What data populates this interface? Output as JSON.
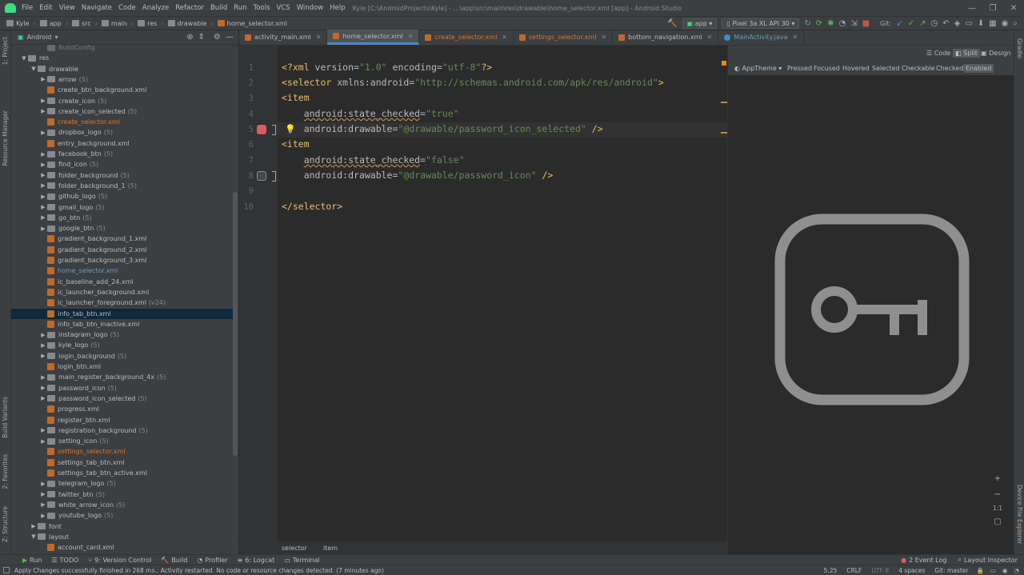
{
  "menubar": {
    "items": [
      "File",
      "Edit",
      "View",
      "Navigate",
      "Code",
      "Analyze",
      "Refactor",
      "Build",
      "Run",
      "Tools",
      "VCS",
      "Window",
      "Help"
    ],
    "title": "Kyle [C:\\AndroidProjects\\Kyle] - ...\\app\\src\\main\\res\\drawable\\home_selector.xml [app] - Android Studio"
  },
  "navbar": {
    "crumbs": [
      "Kyle",
      "app",
      "src",
      "main",
      "res",
      "drawable",
      "home_selector.xml"
    ],
    "run_config": "app",
    "device": "Pixel 3a XL API 30",
    "git_label": "Git:"
  },
  "project": {
    "view_label": "Android",
    "tree": [
      {
        "name": "BuildConfig",
        "count": "",
        "indent": 3,
        "arrow": "",
        "icon": "file",
        "state": "dim"
      },
      {
        "name": "res",
        "count": "",
        "indent": 1,
        "arrow": "▼",
        "icon": "folder",
        "state": ""
      },
      {
        "name": "drawable",
        "count": "",
        "indent": 2,
        "arrow": "▼",
        "icon": "folder",
        "state": ""
      },
      {
        "name": "arrow",
        "count": "(5)",
        "indent": 3,
        "arrow": "▶",
        "icon": "folder",
        "state": ""
      },
      {
        "name": "create_btn_background.xml",
        "count": "",
        "indent": 3,
        "arrow": "",
        "icon": "xml",
        "state": ""
      },
      {
        "name": "create_icon",
        "count": "(5)",
        "indent": 3,
        "arrow": "▶",
        "icon": "folder",
        "state": ""
      },
      {
        "name": "create_icon_selected",
        "count": "(5)",
        "indent": 3,
        "arrow": "▶",
        "icon": "folder",
        "state": ""
      },
      {
        "name": "create_selector.xml",
        "count": "",
        "indent": 3,
        "arrow": "",
        "icon": "xml",
        "state": "mod"
      },
      {
        "name": "dropbox_logo",
        "count": "(5)",
        "indent": 3,
        "arrow": "▶",
        "icon": "folder",
        "state": ""
      },
      {
        "name": "entry_background.xml",
        "count": "",
        "indent": 3,
        "arrow": "",
        "icon": "xml",
        "state": ""
      },
      {
        "name": "facebook_btn",
        "count": "(5)",
        "indent": 3,
        "arrow": "▶",
        "icon": "folder",
        "state": ""
      },
      {
        "name": "find_icon",
        "count": "(5)",
        "indent": 3,
        "arrow": "▶",
        "icon": "folder",
        "state": ""
      },
      {
        "name": "folder_background",
        "count": "(5)",
        "indent": 3,
        "arrow": "▶",
        "icon": "folder",
        "state": ""
      },
      {
        "name": "folder_background_1",
        "count": "(5)",
        "indent": 3,
        "arrow": "▶",
        "icon": "folder",
        "state": ""
      },
      {
        "name": "github_logo",
        "count": "(5)",
        "indent": 3,
        "arrow": "▶",
        "icon": "folder",
        "state": ""
      },
      {
        "name": "gmail_logo",
        "count": "(5)",
        "indent": 3,
        "arrow": "▶",
        "icon": "folder",
        "state": ""
      },
      {
        "name": "go_btn",
        "count": "(5)",
        "indent": 3,
        "arrow": "▶",
        "icon": "folder",
        "state": ""
      },
      {
        "name": "google_btn",
        "count": "(5)",
        "indent": 3,
        "arrow": "▶",
        "icon": "folder",
        "state": ""
      },
      {
        "name": "gradient_background_1.xml",
        "count": "",
        "indent": 3,
        "arrow": "",
        "icon": "xml",
        "state": ""
      },
      {
        "name": "gradient_background_2.xml",
        "count": "",
        "indent": 3,
        "arrow": "",
        "icon": "xml",
        "state": ""
      },
      {
        "name": "gradient_background_3.xml",
        "count": "",
        "indent": 3,
        "arrow": "",
        "icon": "xml",
        "state": ""
      },
      {
        "name": "home_selector.xml",
        "count": "",
        "indent": 3,
        "arrow": "",
        "icon": "xml",
        "state": "blue"
      },
      {
        "name": "ic_baseline_add_24.xml",
        "count": "",
        "indent": 3,
        "arrow": "",
        "icon": "xml",
        "state": ""
      },
      {
        "name": "ic_launcher_background.xml",
        "count": "",
        "indent": 3,
        "arrow": "",
        "icon": "xml",
        "state": ""
      },
      {
        "name": "ic_launcher_foreground.xml",
        "count": "(v24)",
        "indent": 3,
        "arrow": "",
        "icon": "xml",
        "state": ""
      },
      {
        "name": "info_tab_btn.xml",
        "count": "",
        "indent": 3,
        "arrow": "",
        "icon": "xml",
        "state": "sel"
      },
      {
        "name": "info_tab_btn_inactive.xml",
        "count": "",
        "indent": 3,
        "arrow": "",
        "icon": "xml",
        "state": ""
      },
      {
        "name": "instagram_logo",
        "count": "(5)",
        "indent": 3,
        "arrow": "▶",
        "icon": "folder",
        "state": ""
      },
      {
        "name": "kyle_logo",
        "count": "(5)",
        "indent": 3,
        "arrow": "▶",
        "icon": "folder",
        "state": ""
      },
      {
        "name": "login_background",
        "count": "(5)",
        "indent": 3,
        "arrow": "▶",
        "icon": "folder",
        "state": ""
      },
      {
        "name": "login_btn.xml",
        "count": "",
        "indent": 3,
        "arrow": "",
        "icon": "xml",
        "state": ""
      },
      {
        "name": "main_register_background_4x",
        "count": "(5)",
        "indent": 3,
        "arrow": "▶",
        "icon": "folder",
        "state": ""
      },
      {
        "name": "password_icon",
        "count": "(5)",
        "indent": 3,
        "arrow": "▶",
        "icon": "folder",
        "state": ""
      },
      {
        "name": "password_icon_selected",
        "count": "(5)",
        "indent": 3,
        "arrow": "▶",
        "icon": "folder",
        "state": ""
      },
      {
        "name": "progress.xml",
        "count": "",
        "indent": 3,
        "arrow": "",
        "icon": "xml",
        "state": ""
      },
      {
        "name": "register_btn.xml",
        "count": "",
        "indent": 3,
        "arrow": "",
        "icon": "xml",
        "state": ""
      },
      {
        "name": "registration_background",
        "count": "(5)",
        "indent": 3,
        "arrow": "▶",
        "icon": "folder",
        "state": ""
      },
      {
        "name": "setting_icon",
        "count": "(5)",
        "indent": 3,
        "arrow": "▶",
        "icon": "folder",
        "state": ""
      },
      {
        "name": "settings_selector.xml",
        "count": "",
        "indent": 3,
        "arrow": "",
        "icon": "xml",
        "state": "mod"
      },
      {
        "name": "settings_tab_btn.xml",
        "count": "",
        "indent": 3,
        "arrow": "",
        "icon": "xml",
        "state": ""
      },
      {
        "name": "settings_tab_btn_active.xml",
        "count": "",
        "indent": 3,
        "arrow": "",
        "icon": "xml",
        "state": ""
      },
      {
        "name": "telegram_logo",
        "count": "(5)",
        "indent": 3,
        "arrow": "▶",
        "icon": "folder",
        "state": ""
      },
      {
        "name": "twitter_btn",
        "count": "(5)",
        "indent": 3,
        "arrow": "▶",
        "icon": "folder",
        "state": ""
      },
      {
        "name": "white_arrow_icon",
        "count": "(5)",
        "indent": 3,
        "arrow": "▶",
        "icon": "folder",
        "state": ""
      },
      {
        "name": "youtube_logo",
        "count": "(5)",
        "indent": 3,
        "arrow": "▶",
        "icon": "folder",
        "state": ""
      },
      {
        "name": "font",
        "count": "",
        "indent": 2,
        "arrow": "▶",
        "icon": "folder",
        "state": ""
      },
      {
        "name": "layout",
        "count": "",
        "indent": 2,
        "arrow": "▼",
        "icon": "folder",
        "state": ""
      },
      {
        "name": "account_card.xml",
        "count": "",
        "indent": 3,
        "arrow": "",
        "icon": "xml",
        "state": ""
      }
    ]
  },
  "tabs": [
    {
      "label": "activity_main.xml",
      "type": "xml",
      "state": ""
    },
    {
      "label": "home_selector.xml",
      "type": "xml",
      "state": "active"
    },
    {
      "label": "create_selector.xml",
      "type": "xml",
      "state": "mod"
    },
    {
      "label": "settings_selector.xml",
      "type": "xml",
      "state": "mod"
    },
    {
      "label": "bottom_navigation.xml",
      "type": "xml",
      "state": ""
    },
    {
      "label": "MainActivity.java",
      "type": "java",
      "state": "blue"
    }
  ],
  "editor": {
    "line_numbers": [
      "1",
      "2",
      "3",
      "4",
      "5",
      "6",
      "7",
      "8",
      "9",
      "10"
    ],
    "breadcrumb": [
      "selector",
      "item"
    ]
  },
  "preview": {
    "view_modes": [
      "Code",
      "Split",
      "Design"
    ],
    "theme": "AppTheme",
    "states": [
      "Pressed",
      "Focused",
      "Hovered",
      "Selected",
      "Checkable",
      "Checked",
      "Enabled"
    ],
    "zoom_ratio": "1:1"
  },
  "side_labels": {
    "left": [
      "1: Project",
      "Resource Manager",
      "Build Variants",
      "2: Favorites",
      "Z: Structure"
    ],
    "right": [
      "Gradle",
      "Device File Explorer"
    ]
  },
  "toolwindows": [
    "Run",
    "TODO",
    "9: Version Control",
    "Build",
    "Profiler",
    "6: Logcat",
    "Terminal"
  ],
  "toolwindows_right": [
    "2 Event Log",
    "Layout Inspector"
  ],
  "statusbar": {
    "message": "Apply Changes successfully finished in 268 ms.: Activity restarted. No code or resource changes detected. (7 minutes ago)",
    "position": "5:25",
    "line_sep": "CRLF",
    "encoding": "UTF-8",
    "indent": "4 spaces",
    "git": "Git: master"
  },
  "colors": {
    "accent": "#4a88c7",
    "modified": "#d9772b",
    "tag": "#e8bf6a",
    "attr_value": "#6a8759",
    "breakpoint": "#db5c5c"
  }
}
